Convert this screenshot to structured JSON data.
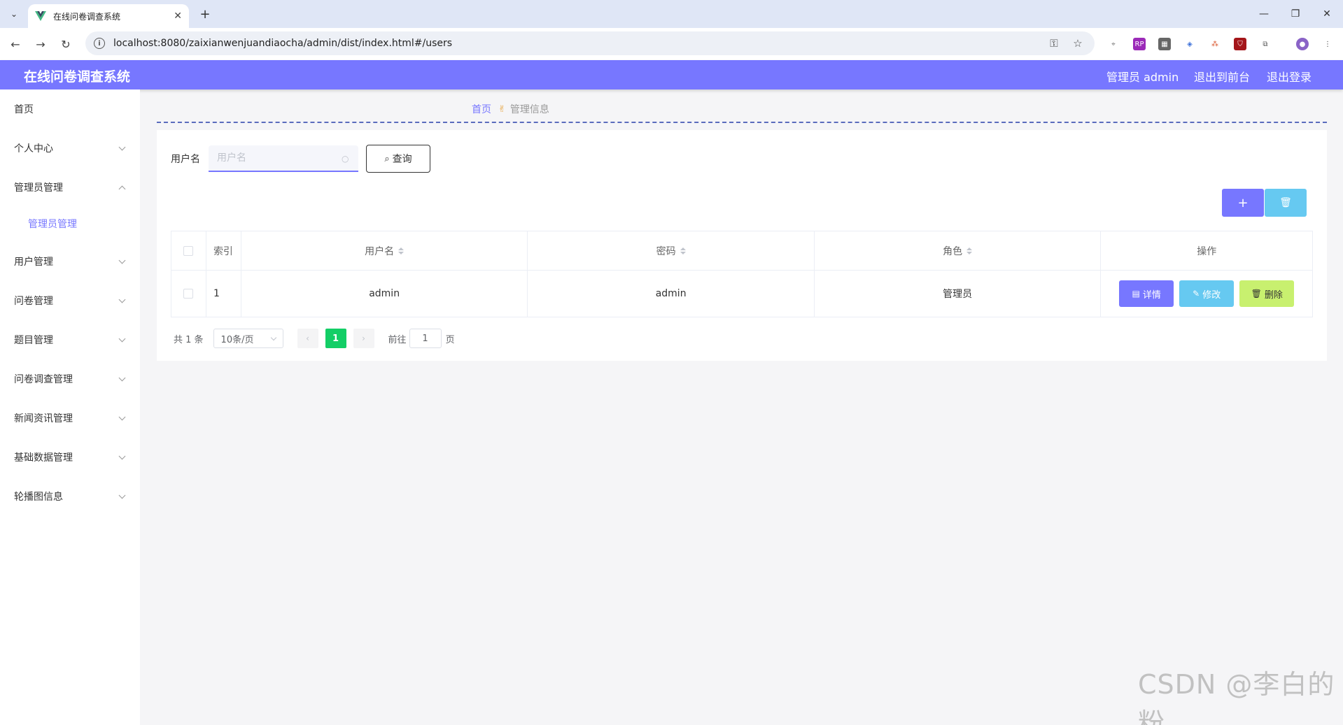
{
  "browser": {
    "tab_title": "在线问卷调查系统",
    "url": "localhost:8080/zaixianwenjuandiaocha/admin/dist/index.html#/users"
  },
  "header": {
    "title": "在线问卷调查系统",
    "user": "管理员 admin",
    "to_front": "退出到前台",
    "logout": "退出登录"
  },
  "sidebar": {
    "items": [
      {
        "label": "首页"
      },
      {
        "label": "个人中心"
      },
      {
        "label": "管理员管理"
      },
      {
        "label": "管理员管理"
      },
      {
        "label": "用户管理"
      },
      {
        "label": "问卷管理"
      },
      {
        "label": "题目管理"
      },
      {
        "label": "问卷调查管理"
      },
      {
        "label": "新闻资讯管理"
      },
      {
        "label": "基础数据管理"
      },
      {
        "label": "轮播图信息"
      }
    ]
  },
  "breadcrumb": {
    "home": "首页",
    "current": "管理信息"
  },
  "search": {
    "label": "用户名",
    "placeholder": "用户名",
    "button": "查询"
  },
  "actions": {
    "add": "+",
    "delete_icon": "trash-icon"
  },
  "table": {
    "headers": {
      "index": "索引",
      "username": "用户名",
      "password": "密码",
      "role": "角色",
      "ops": "操作"
    },
    "rows": [
      {
        "index": "1",
        "username": "admin",
        "password": "admin",
        "role": "管理员"
      }
    ],
    "ops": {
      "detail": "详情",
      "edit": "修改",
      "delete": "删除"
    }
  },
  "pagination": {
    "total": "共 1 条",
    "page_size": "10条/页",
    "current_page": "1",
    "goto_label": "前往",
    "goto_value": "1",
    "page_suffix": "页"
  },
  "watermark": "CSDN @李白的粉",
  "colors": {
    "primary": "#7777ff",
    "info": "#66c9f1",
    "lime": "#c8f06f",
    "success": "#13ce66"
  }
}
